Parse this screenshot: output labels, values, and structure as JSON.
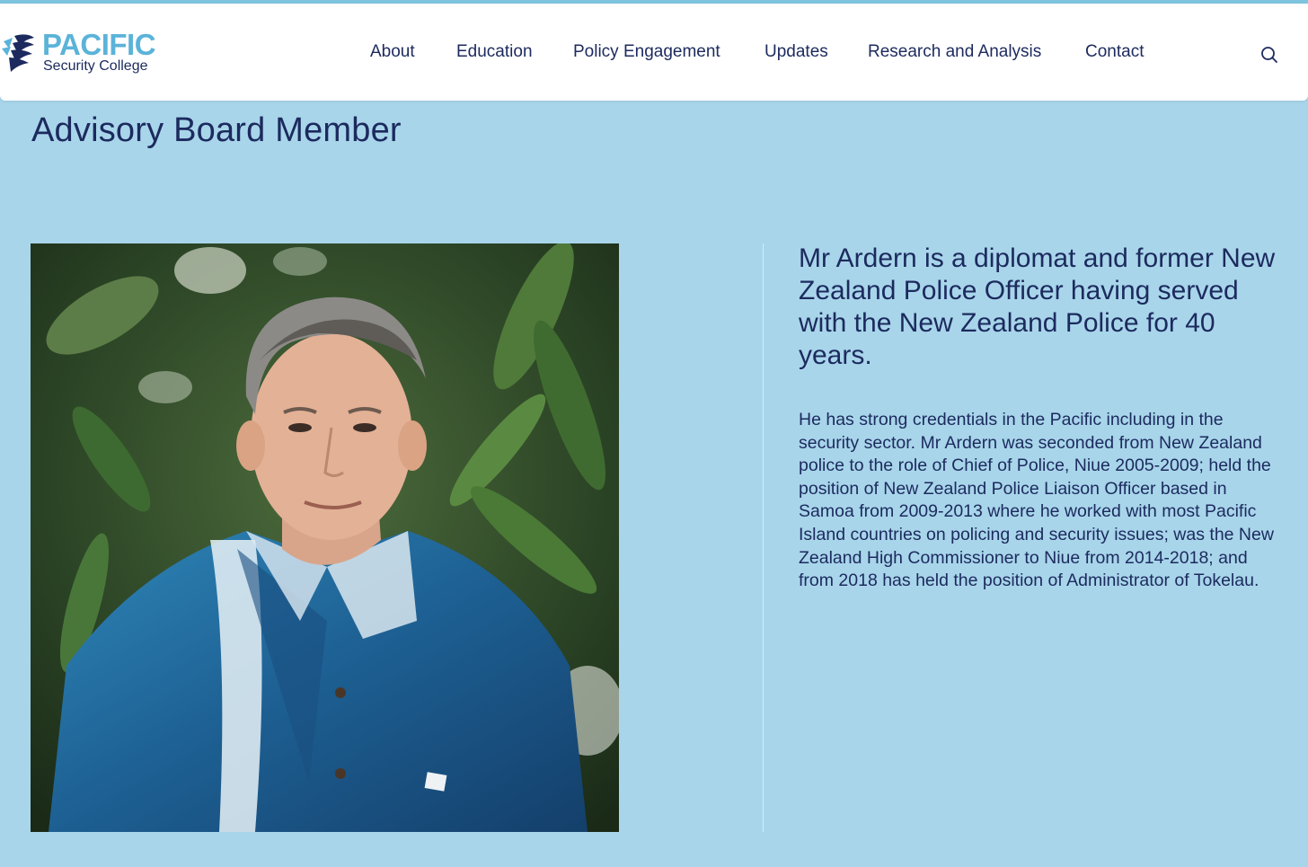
{
  "brand": {
    "title": "PACIFIC",
    "subtitle": "Security College",
    "primary_color": "#5bb3d9",
    "text_color": "#1c2a5e",
    "page_background": "#a8d5ea"
  },
  "nav": {
    "items": [
      {
        "label": "About"
      },
      {
        "label": "Education"
      },
      {
        "label": "Policy Engagement"
      },
      {
        "label": "Updates"
      },
      {
        "label": "Research and Analysis"
      },
      {
        "label": "Contact"
      }
    ],
    "search_icon": "search-icon"
  },
  "page": {
    "title": "Advisory Board Member"
  },
  "profile": {
    "lead": "Mr Ardern is a diplomat and former New Zealand Police Officer having served with the New Zealand Police for 40 years.",
    "body": "He has strong credentials in the Pacific including in the security sector. Mr Ardern was seconded from New Zealand police to the role of Chief of Police, Niue 2005-2009; held the position of New Zealand Police Liaison Officer based in Samoa from 2009-2013 where he worked with most Pacific Island countries on policing and security issues; was the New Zealand High Commissioner to Niue from 2014-2018; and from 2018 has held the position of Administrator of Tokelau."
  }
}
